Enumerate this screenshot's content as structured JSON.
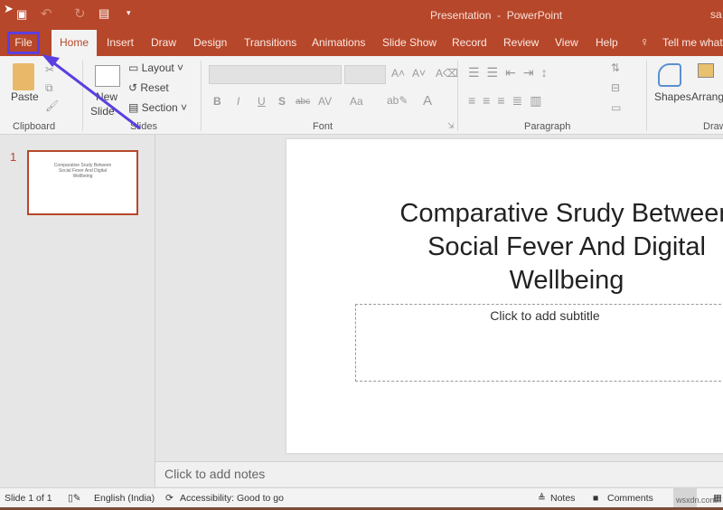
{
  "window": {
    "title": "Presentation  -  PowerPoint",
    "user": "sa"
  },
  "quick_access": {
    "icons": [
      "save-icon",
      "undo-icon",
      "redo-icon",
      "start-slideshow-icon",
      "customize-icon"
    ]
  },
  "tabs": [
    "File",
    "Home",
    "Insert",
    "Draw",
    "Design",
    "Transitions",
    "Animations",
    "Slide Show",
    "Record",
    "Review",
    "View",
    "Help"
  ],
  "tell_me": "Tell me what",
  "ribbon": {
    "clipboard": {
      "label": "Clipboard",
      "paste": "Paste"
    },
    "slides": {
      "label": "Slides",
      "new_slide_1": "New",
      "new_slide_2": "Slide",
      "layout": "Layout",
      "reset": "Reset",
      "section": "Section"
    },
    "font": {
      "label": "Font",
      "buttons": [
        "B",
        "I",
        "U",
        "S",
        "abc",
        "AV",
        "Aa",
        "A"
      ]
    },
    "paragraph": {
      "label": "Paragraph"
    },
    "drawing": {
      "label": "Draw",
      "shapes": "Shapes",
      "arrange": "Arrang"
    }
  },
  "thumbnails": [
    {
      "number": "1",
      "text": "Comparative Srudy Between Social Fever And Digital Wellbeing"
    }
  ],
  "slide": {
    "title": "Comparative Srudy Between Social Fever And Digital Wellbeing",
    "subtitle_placeholder": "Click to add subtitle"
  },
  "notes_placeholder": "Click to add notes",
  "status": {
    "slide": "Slide 1 of 1",
    "language": "English (India)",
    "accessibility": "Accessibility: Good to go",
    "notes": "Notes",
    "comments": "Comments",
    "watermark": "wsxdn.com"
  },
  "colors": {
    "accent": "#b7472a",
    "annotation": "#5b3fe0"
  }
}
